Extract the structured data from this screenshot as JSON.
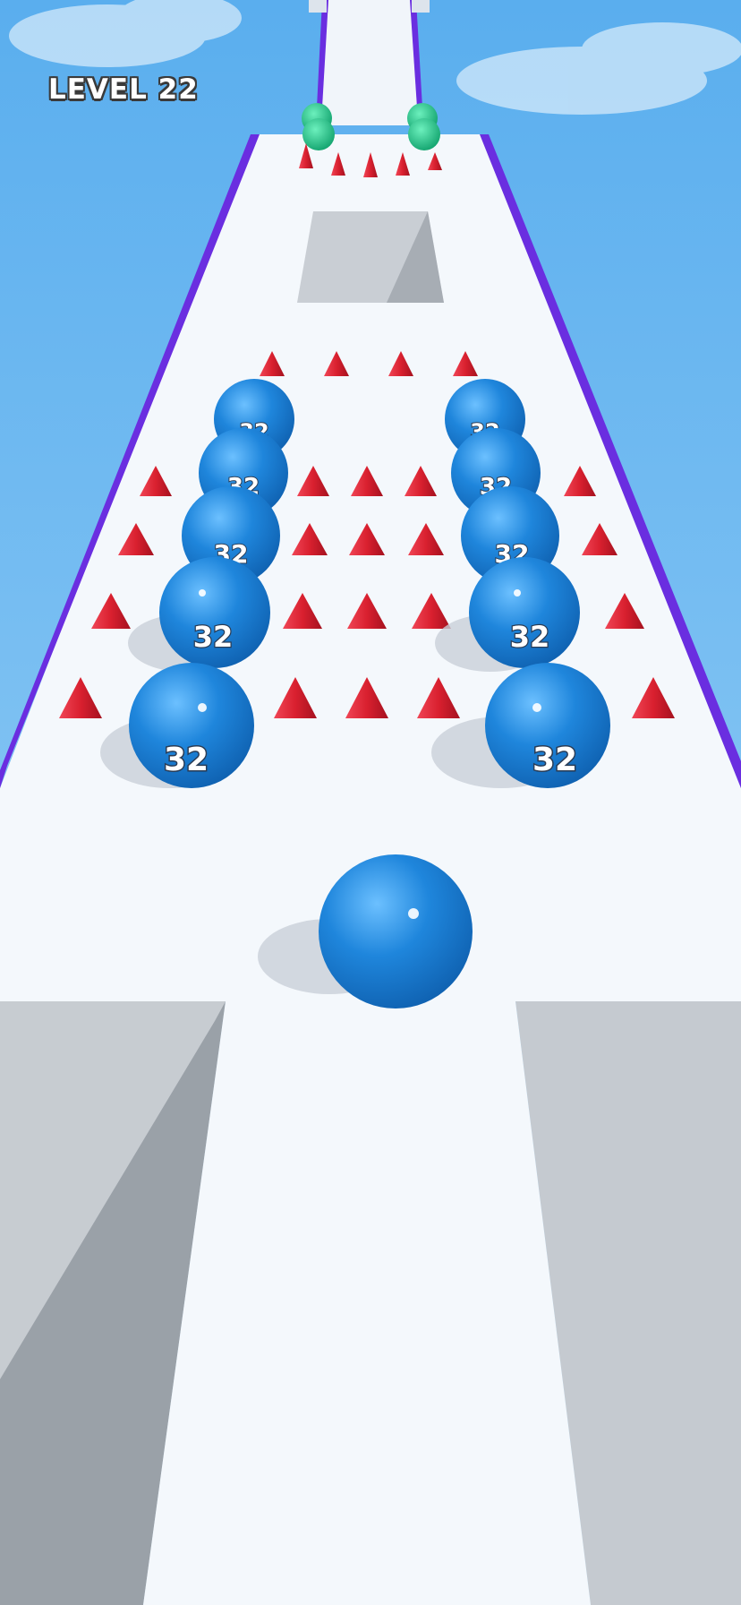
{
  "hud": {
    "level_label": "LEVEL 22"
  },
  "colors": {
    "sky_top": "#5fb1ee",
    "sky_bottom": "#9fd3f7",
    "track": "#f4f8fc",
    "rail": "#6a2ee0",
    "ball": "#1f86dc",
    "spike": "#e0283a",
    "gate": "#22c98a",
    "pit": "#c8ccd2"
  },
  "balls": {
    "number_label": "32",
    "player_icon": "player-ball-icon",
    "target_icon": "ball-32-icon"
  },
  "hazards": {
    "spike_icon": "spike-cone-icon",
    "pit_icon": "pit-hole-icon",
    "gate_icon": "green-gate-post-icon"
  }
}
